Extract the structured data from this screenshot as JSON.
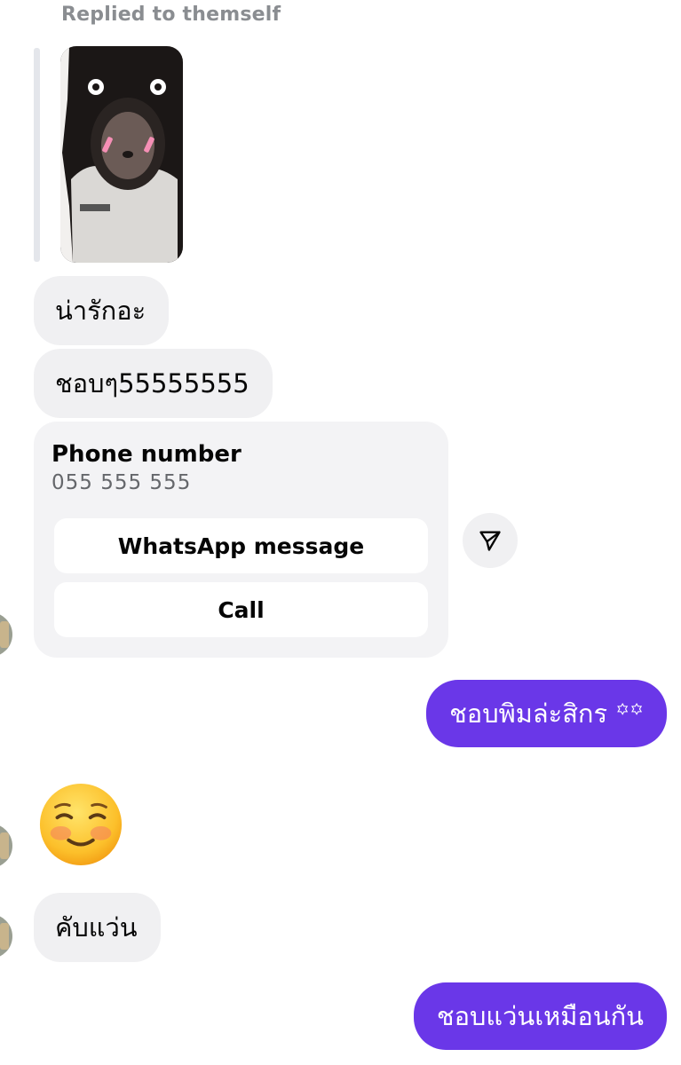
{
  "thread": {
    "reply_header": "Replied to themself",
    "messages_in": [
      {
        "text": "น่ารักอะ"
      },
      {
        "text": "ชอบๆ55555555"
      },
      {
        "text": "คับแว่น"
      }
    ],
    "contact_card": {
      "title": "Phone number",
      "number": "055 555 555",
      "whatsapp_label": "WhatsApp message",
      "call_label": "Call"
    },
    "messages_out": [
      {
        "text": "ชอบพิมล่ะสิกร ꙳꙳"
      },
      {
        "text": "ชอบแว่นเหมือนกัน"
      }
    ],
    "emoji_reaction": "smiling-face-emoji"
  },
  "colors": {
    "outgoing_bubble": "#6a37e8",
    "incoming_bubble": "#f0f0f2",
    "card_background": "#f3f3f5",
    "muted_text": "#8a8d91"
  },
  "icons": {
    "forward": "send-forward-icon"
  }
}
